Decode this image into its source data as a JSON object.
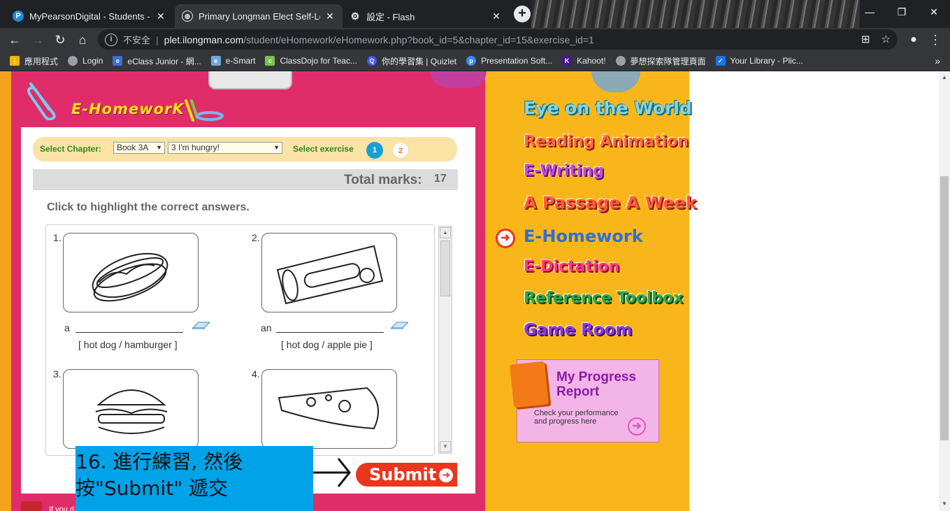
{
  "tabs": [
    {
      "title": "MyPearsonDigital - Students -",
      "icon": "pearson-icon",
      "active": false
    },
    {
      "title": "Primary Longman Elect Self-Le",
      "icon": "globe-icon",
      "active": true
    },
    {
      "title": "設定 - Flash",
      "icon": "gear-icon",
      "active": false
    }
  ],
  "address": {
    "insecure_label": "不安全",
    "host": "plet.ilongman.com",
    "path": "/student/eHomework/eHomework.php?book_id=5&chapter_id=15&exercise_id=1"
  },
  "bookmarks": [
    {
      "label": "應用程式",
      "icon": "apps-grid-icon",
      "color": "#f4b400"
    },
    {
      "label": "Login",
      "icon": "globe-icon",
      "color": "#9aa0a6"
    },
    {
      "label": "eClass Junior - 網...",
      "icon": "eclass-icon",
      "color": "#3b6fd6"
    },
    {
      "label": "e-Smart",
      "icon": "esmart-icon",
      "color": "#6fa8dc"
    },
    {
      "label": "ClassDojo for Teac...",
      "icon": "classdojo-icon",
      "color": "#7cc24a"
    },
    {
      "label": "你的學習集 | Quizlet",
      "icon": "quizlet-icon",
      "color": "#4255ff"
    },
    {
      "label": "Presentation Soft...",
      "icon": "prezi-icon",
      "color": "#318bff"
    },
    {
      "label": "Kahoot!",
      "icon": "kahoot-icon",
      "color": "#46178f"
    },
    {
      "label": "夢想探索隊管理頁面",
      "icon": "globe-icon",
      "color": "#9aa0a6"
    },
    {
      "label": "Your Library - Plic...",
      "icon": "checkbox-icon",
      "color": "#1a73e8"
    }
  ],
  "homework": {
    "title": "E-HomeworK",
    "select_chapter_label": "Select Chapter:",
    "book_value": "Book 3A",
    "chapter_value": "3 I'm hungry!",
    "select_exercise_label": "Select exercise",
    "exercises": [
      "1",
      "2"
    ],
    "total_marks_label": "Total marks:",
    "total_marks_value": "17",
    "instruction": "Click to highlight the correct answers.",
    "questions": [
      {
        "num": "1.",
        "article": "a",
        "options": "[ hot dog / hamburger ]",
        "image": "hot-dog-image"
      },
      {
        "num": "2.",
        "article": "an",
        "options": "[ hot dog / apple pie ]",
        "image": "apple-pie-image"
      },
      {
        "num": "3.",
        "article": "",
        "options": "",
        "image": "hamburger-image"
      },
      {
        "num": "4.",
        "article": "",
        "options": "",
        "image": "pizza-image"
      }
    ],
    "submit_label": "Submit"
  },
  "callout": {
    "line1": "16. 進行練習, 然後",
    "line2": "按\"Submit\" 遞交"
  },
  "flash_notice": "If you d",
  "nav": {
    "eye": "Eye on the World",
    "reading": "Reading Animation",
    "writing": "E-Writing",
    "passage": "A Passage A Week",
    "ehomework": "E-Homework",
    "dictation": "E-Dictation",
    "reference": "Reference Toolbox",
    "game": "Game Room"
  },
  "progress": {
    "title_line1": "My Progress",
    "title_line2": "Report",
    "sub_line1": "Check your performance",
    "sub_line2": "and progress here"
  },
  "colors": {
    "pink_panel": "#e02d6a",
    "orange_panel": "#f9b61b",
    "callout_bg": "#00a2e8",
    "submit": "#e8371d"
  }
}
